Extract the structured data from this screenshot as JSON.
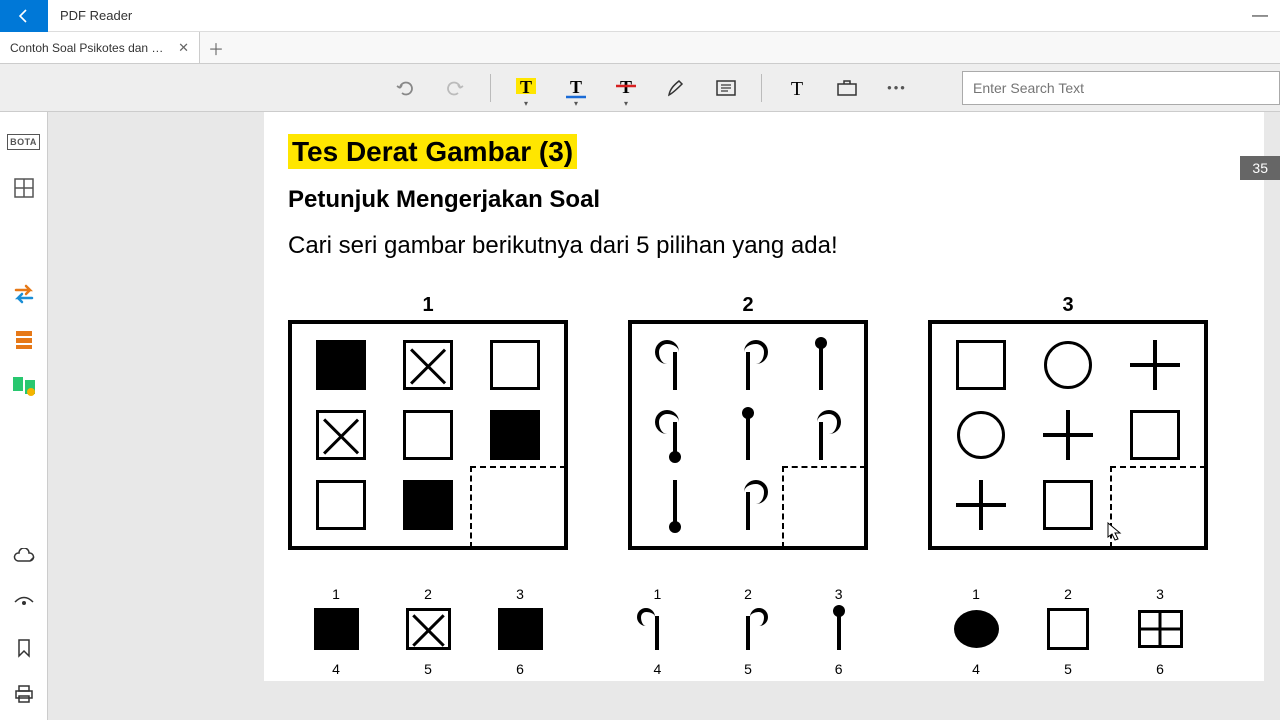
{
  "app": {
    "title": "PDF Reader"
  },
  "tab": {
    "label": "Contoh Soal Psikotes dan Jawab..."
  },
  "toolbar": {
    "search_placeholder": "Enter Search Text"
  },
  "page_counter": "35",
  "doc": {
    "title": "Tes Derat Gambar (3)",
    "subtitle": "Petunjuk Mengerjakan Soal",
    "instruction": "Cari seri gambar berikutnya dari 5 pilihan yang ada!"
  },
  "puzzles": [
    {
      "num": "1",
      "choices": [
        "1",
        "2",
        "3",
        "4",
        "5",
        "6"
      ]
    },
    {
      "num": "2",
      "choices": [
        "1",
        "2",
        "3",
        "4",
        "5",
        "6"
      ]
    },
    {
      "num": "3",
      "choices": [
        "1",
        "2",
        "3",
        "4",
        "5",
        "6"
      ]
    }
  ]
}
